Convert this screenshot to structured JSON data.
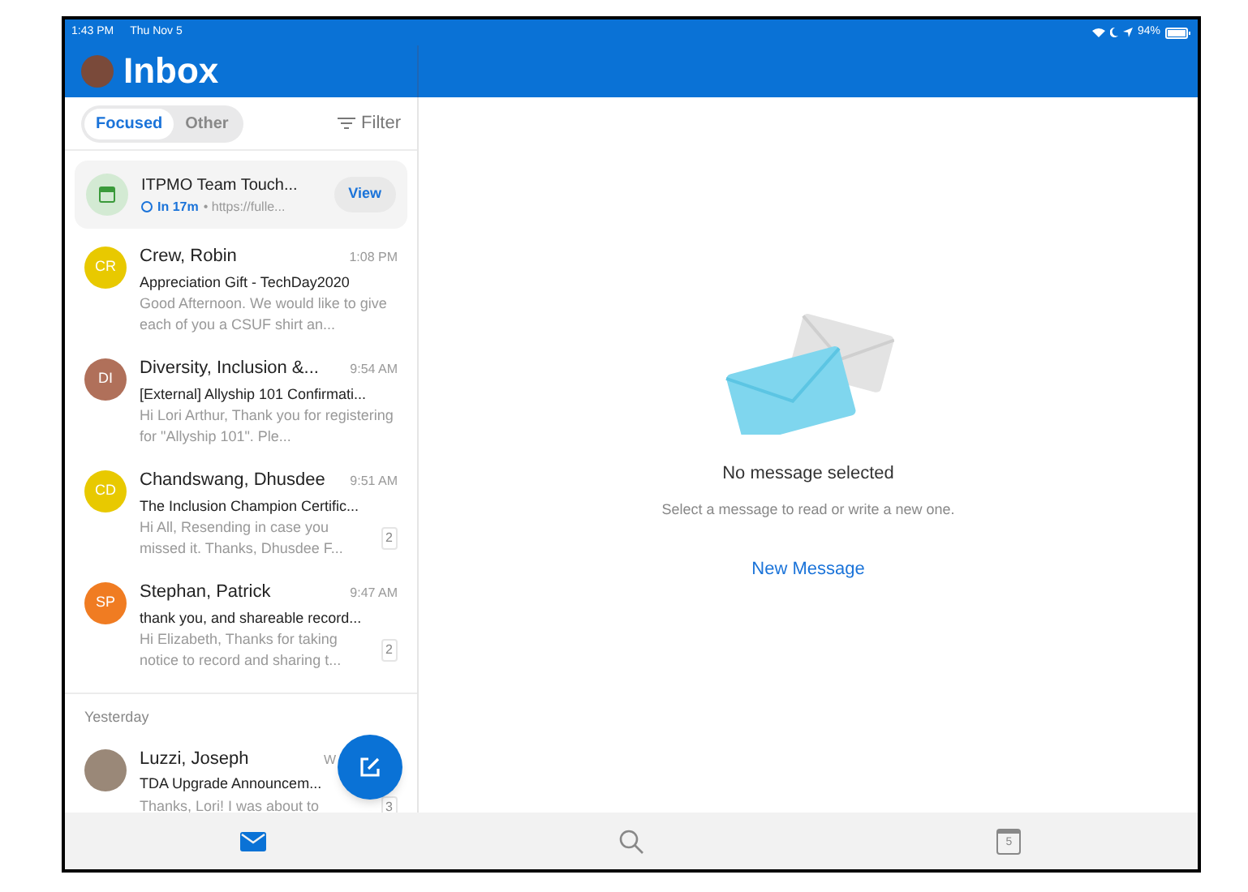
{
  "status_bar": {
    "time": "1:43 PM",
    "date": "Thu Nov 5",
    "battery": "94%"
  },
  "header": {
    "title": "Inbox"
  },
  "inbox_tabs": [
    {
      "label": "Focused",
      "selected": true
    },
    {
      "label": "Other",
      "selected": false
    }
  ],
  "filter": {
    "label": "Filter"
  },
  "event_card": {
    "title": "ITPMO Team Touch...",
    "time": "In 17m",
    "link": "• https://fulle...",
    "button": "View"
  },
  "messages": [
    {
      "initials": "CR",
      "kind": "initials",
      "color": "#e8c900",
      "sender": "Crew, Robin",
      "time": "1:08 PM",
      "subject": "Appreciation Gift - TechDay2020",
      "preview": "Good Afternoon. We would like to give each of you a CSUF shirt an..."
    },
    {
      "initials": "DI",
      "kind": "initials",
      "color": "#b0705a",
      "sender": "Diversity, Inclusion &...",
      "time": "9:54 AM",
      "subject": "[External] Allyship 101 Confirmati...",
      "preview": "Hi Lori Arthur, Thank you for registering for \"Allyship 101\". Ple..."
    },
    {
      "initials": "CD",
      "kind": "initials",
      "color": "#e8c900",
      "sender": "Chandswang, Dhusdee",
      "time": "9:51 AM",
      "subject": "The Inclusion Champion Certific...",
      "preview": "Hi All, Resending in case you missed it. Thanks, Dhusdee F...",
      "count": "2"
    },
    {
      "initials": "SP",
      "kind": "initials",
      "color": "#f07c22",
      "sender": "Stephan, Patrick",
      "time": "9:47 AM",
      "subject": "thank you, and shareable  record...",
      "preview": "Hi Elizabeth, Thanks for taking notice to record and sharing t...",
      "count": "2"
    }
  ],
  "section": "Yesterday",
  "messages_yesterday": [
    {
      "kind": "photo",
      "sender": "Luzzi, Joseph",
      "time": "W",
      "subject": "TDA Upgrade Announcem...",
      "preview": "Thanks, Lori! I was about to",
      "count": "3"
    }
  ],
  "reading_pane": {
    "title": "No message selected",
    "subtitle": "Select a message to read or write a new one.",
    "link": "New Message"
  },
  "tab_bar": [
    {
      "kind": "mail",
      "selected": true
    },
    {
      "kind": "search",
      "selected": false
    },
    {
      "kind": "calendar",
      "selected": false,
      "day": "5"
    }
  ]
}
